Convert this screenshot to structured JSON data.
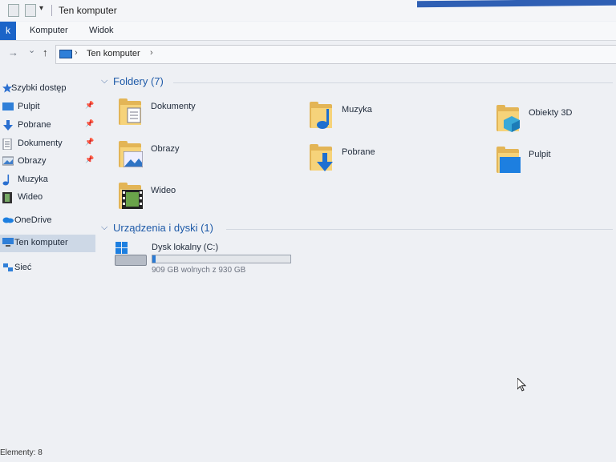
{
  "window": {
    "title": "Ten komputer"
  },
  "ribbon": {
    "file_tab": "k",
    "tabs": [
      "Komputer",
      "Widok"
    ]
  },
  "address": {
    "crumb": "Ten komputer",
    "separator": "›"
  },
  "nav": {
    "forward_glyph": "→",
    "recent_glyph": "⌄",
    "up_glyph": "↑"
  },
  "sidebar": {
    "quick_access": "Szybki dostęp",
    "items": [
      {
        "label": "Pulpit",
        "pinned": true
      },
      {
        "label": "Pobrane",
        "pinned": true
      },
      {
        "label": "Dokumenty",
        "pinned": true
      },
      {
        "label": "Obrazy",
        "pinned": true
      },
      {
        "label": "Muzyka",
        "pinned": false
      },
      {
        "label": "Wideo",
        "pinned": false
      }
    ],
    "onedrive": "OneDrive",
    "this_pc": "Ten komputer",
    "network": "Sieć"
  },
  "folders_group": {
    "title": "Foldery (7)"
  },
  "folders": [
    {
      "name": "Dokumenty",
      "icon": "documents-icon"
    },
    {
      "name": "Muzyka",
      "icon": "music-icon"
    },
    {
      "name": "Obiekty 3D",
      "icon": "3d-objects-icon"
    },
    {
      "name": "Obrazy",
      "icon": "pictures-icon"
    },
    {
      "name": "Pobrane",
      "icon": "downloads-icon"
    },
    {
      "name": "Pulpit",
      "icon": "desktop-icon"
    },
    {
      "name": "Wideo",
      "icon": "videos-icon"
    }
  ],
  "drives_group": {
    "title": "Urządzenia i dyski (1)"
  },
  "drive": {
    "name": "Dysk lokalny (C:)",
    "free_text": "909 GB wolnych z 930 GB",
    "used_fraction": 0.023
  },
  "status": {
    "items": "Elementy: 8"
  },
  "colors": {
    "accent": "#1b64c8",
    "folder": "#e3b556",
    "link": "#1e5aa8"
  }
}
